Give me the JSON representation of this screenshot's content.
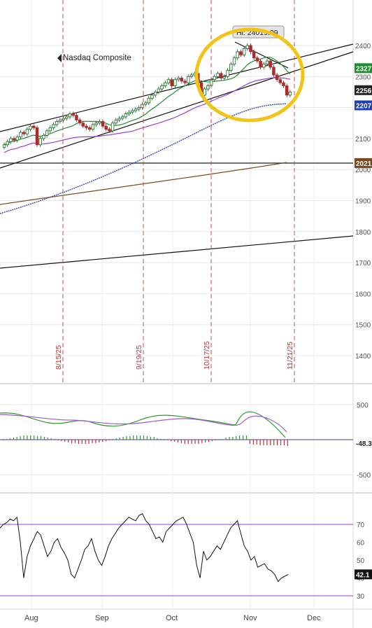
{
  "chart_data": [
    {
      "type": "candlestick",
      "title": "Nasdaq Composite",
      "annotation": "Hi: 24019.99",
      "ylim": [
        13000,
        24600
      ],
      "y_ticks": [
        "2400",
        "2300",
        "2200",
        "2100",
        "2000",
        "1900",
        "1800",
        "1700",
        "1600",
        "1500",
        "1400"
      ],
      "last_value_tags": [
        {
          "text": "2327",
          "value": 23270,
          "color": "#1f8c2f"
        },
        {
          "text": "2256",
          "value": 22560,
          "color": "#222222"
        },
        {
          "text": "2207",
          "value": 22070,
          "color": "#1f3fb3"
        },
        {
          "text": "2021",
          "value": 20210,
          "color": "#7a4a1c"
        }
      ],
      "event_markers": [
        {
          "label": "8/15/25"
        },
        {
          "label": "9/19/25"
        },
        {
          "label": "10/17/25"
        },
        {
          "label": "11/21/25"
        }
      ],
      "horizontal_line": 20210,
      "closes": [
        20800,
        20900,
        21000,
        20950,
        21050,
        21200,
        21150,
        21300,
        21400,
        21350,
        20800,
        21000,
        21100,
        21250,
        21350,
        21450,
        21550,
        21600,
        21650,
        21700,
        21800,
        21750,
        21600,
        21500,
        21400,
        21350,
        21300,
        21450,
        21500,
        21550,
        21400,
        21300,
        21250,
        21500,
        21600,
        21650,
        21700,
        21800,
        21850,
        21900,
        21950,
        22000,
        22100,
        22150,
        22300,
        22400,
        22500,
        22600,
        22700,
        22800,
        22900,
        22700,
        22900,
        22950,
        22850,
        22800,
        23000,
        23050,
        23100,
        22800,
        22400,
        22600,
        22700,
        22900,
        23000,
        23100,
        22950,
        23000,
        23200,
        23400,
        23600,
        23800,
        23700,
        23900,
        24000,
        23800,
        23600,
        23500,
        23300,
        23400,
        23500,
        23300,
        23050,
        22900,
        22800,
        22700,
        22400,
        22500
      ],
      "colors": {
        "up": "#1f7a2a",
        "down": "#b02a2a"
      },
      "x_month_labels": [
        "Aug",
        "Sep",
        "Oct",
        "Nov",
        "Dec"
      ]
    },
    {
      "type": "macd",
      "ylim": [
        -650,
        700
      ],
      "y_ticks": [
        "500",
        "-500"
      ],
      "last_value_tag": "-48.3",
      "macd_line_color": "#2f9a2f",
      "signal_line_color": "#a25ad0"
    },
    {
      "type": "rsi",
      "ylim": [
        24,
        80
      ],
      "y_ticks": [
        "70",
        "60",
        "50",
        "40",
        "30"
      ],
      "levels": [
        70,
        30
      ],
      "last_value_tag": "42.1",
      "values": [
        68,
        70,
        71,
        73,
        72,
        74,
        60,
        40,
        52,
        58,
        62,
        66,
        64,
        58,
        52,
        55,
        60,
        62,
        57,
        54,
        50,
        42,
        40,
        45,
        50,
        56,
        58,
        62,
        55,
        50,
        47,
        52,
        58,
        62,
        65,
        68,
        70,
        72,
        74,
        73,
        72,
        75,
        76,
        72,
        70,
        66,
        62,
        63,
        60,
        66,
        68,
        70,
        72,
        73,
        74,
        70,
        65,
        60,
        47,
        40,
        55,
        50,
        52,
        55,
        58,
        56,
        60,
        64,
        68,
        70,
        72,
        65,
        58,
        55,
        50,
        52,
        46,
        47,
        48,
        45,
        44,
        42,
        38,
        40,
        41,
        42
      ]
    }
  ]
}
